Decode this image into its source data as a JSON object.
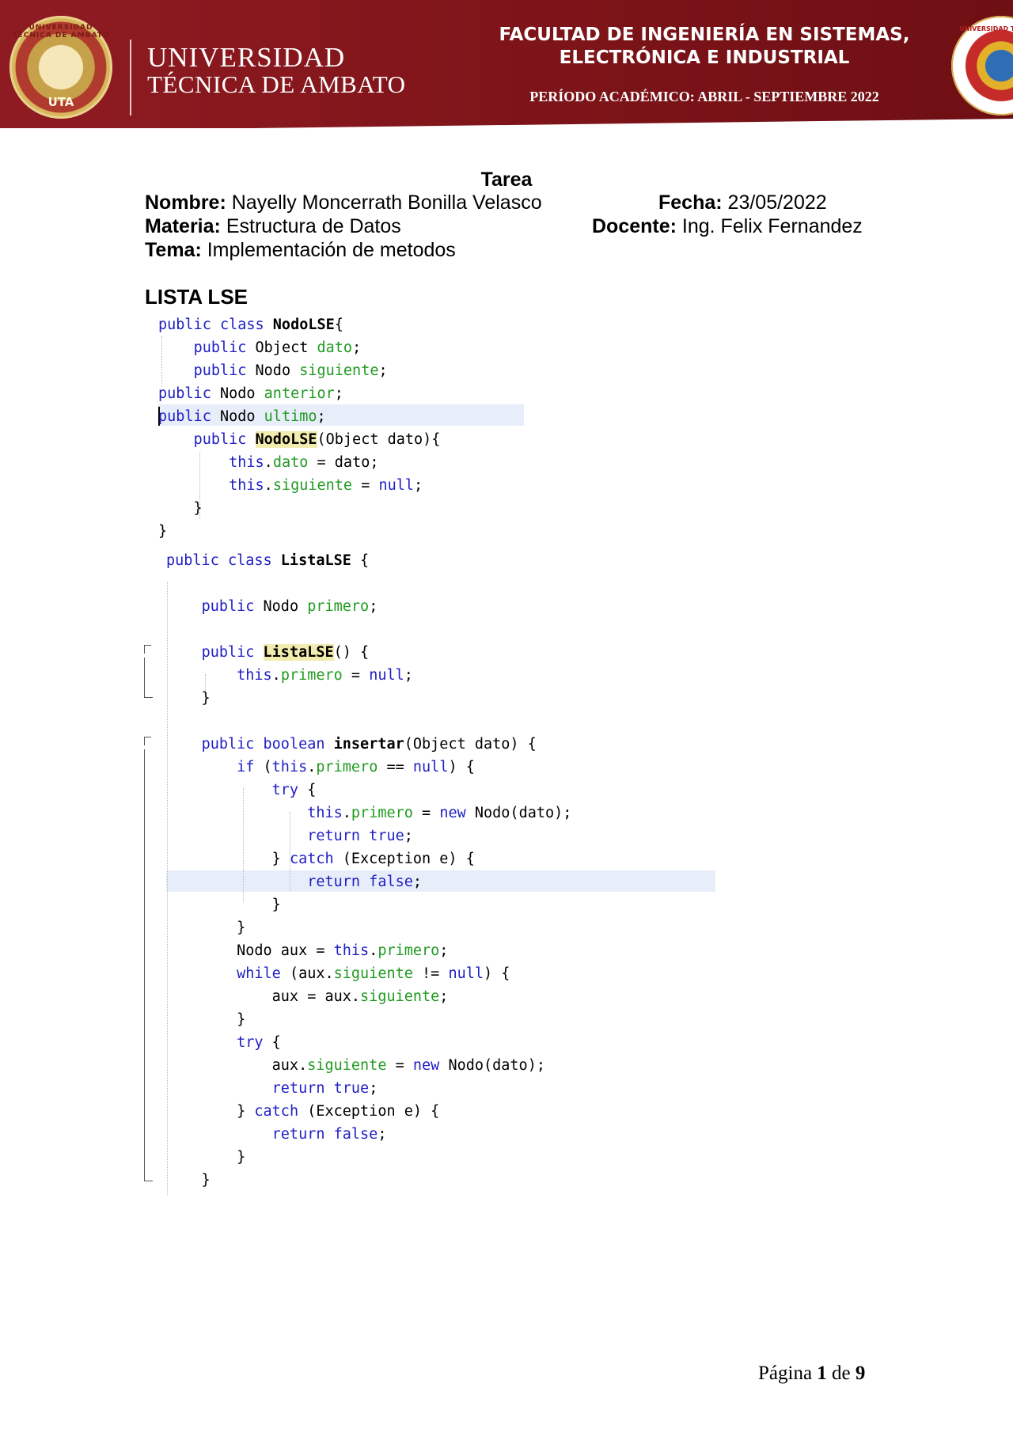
{
  "header": {
    "university_line1": "UNIVERSIDAD",
    "university_line2": "TÉCNICA DE AMBATO",
    "seal_left_text": "UTA",
    "seal_left_arc": "UNIVERSIDAD TÉCNICA DE AMBATO",
    "seal_right_arc": "UNIVERSIDAD TÉCNICA",
    "faculty_line1": "FACULTAD DE INGENIERÍA EN SISTEMAS,",
    "faculty_line2": "ELECTRÓNICA E INDUSTRIAL",
    "period": "PERÍODO ACADÉMICO: ABRIL - SEPTIEMBRE 2022",
    "brand_color": "#8f1b22"
  },
  "document": {
    "title": "Tarea",
    "nombre_label": "Nombre:",
    "nombre_value": " Nayelly Moncerrath Bonilla Velasco",
    "materia_label": "Materia:",
    "materia_value": " Estructura de Datos",
    "tema_label": "Tema:",
    "tema_value": " Implementación de metodos",
    "fecha_label": "Fecha:",
    "fecha_value": " 23/05/2022",
    "docente_label": "Docente:",
    "docente_value": " Ing. Felix Fernandez",
    "section_title": "LISTA LSE"
  },
  "code1": [
    [
      [
        "kw",
        "public class "
      ],
      [
        "bold",
        "NodoLSE"
      ],
      [
        "",
        "{"
      ]
    ],
    [
      [
        "",
        "    "
      ],
      [
        "kw",
        "public "
      ],
      [
        "",
        "Object "
      ],
      [
        "fld",
        "dato"
      ],
      [
        "",
        ";"
      ]
    ],
    [
      [
        "",
        "    "
      ],
      [
        "kw",
        "public "
      ],
      [
        "",
        "Nodo "
      ],
      [
        "fld",
        "siguiente"
      ],
      [
        "",
        ";"
      ]
    ],
    [
      [
        "kw",
        "public "
      ],
      [
        "",
        "Nodo "
      ],
      [
        "fld",
        "anterior"
      ],
      [
        "",
        ";"
      ]
    ],
    [
      [
        "kw",
        "public "
      ],
      [
        "",
        "Nodo "
      ],
      [
        "fld",
        "ultimo"
      ],
      [
        "",
        ";"
      ]
    ],
    [
      [
        "",
        "    "
      ],
      [
        "kw",
        "public "
      ],
      [
        "hl",
        "NodoLSE"
      ],
      [
        "",
        "(Object dato){"
      ]
    ],
    [
      [
        "",
        "        "
      ],
      [
        "kw",
        "this"
      ],
      [
        "",
        "."
      ],
      [
        "fld",
        "dato"
      ],
      [
        "",
        " = dato;"
      ]
    ],
    [
      [
        "",
        "        "
      ],
      [
        "kw",
        "this"
      ],
      [
        "",
        "."
      ],
      [
        "fld",
        "siguiente"
      ],
      [
        "",
        " = "
      ],
      [
        "kw",
        "null"
      ],
      [
        "",
        ";"
      ]
    ],
    [
      [
        "",
        "    }"
      ]
    ],
    [
      [
        "",
        "}"
      ]
    ]
  ],
  "code2": [
    [
      [
        "kw",
        "public class "
      ],
      [
        "bold",
        "ListaLSE"
      ],
      [
        "",
        " {"
      ]
    ],
    [
      [
        "",
        ""
      ]
    ],
    [
      [
        "",
        "    "
      ],
      [
        "kw",
        "public "
      ],
      [
        "",
        "Nodo "
      ],
      [
        "fld",
        "primero"
      ],
      [
        "",
        ";"
      ]
    ],
    [
      [
        "",
        ""
      ]
    ],
    [
      [
        "",
        "    "
      ],
      [
        "kw",
        "public "
      ],
      [
        "hl",
        "ListaLSE"
      ],
      [
        "",
        "() {"
      ]
    ],
    [
      [
        "",
        "        "
      ],
      [
        "kw",
        "this"
      ],
      [
        "",
        "."
      ],
      [
        "fld",
        "primero"
      ],
      [
        "",
        " = "
      ],
      [
        "kw",
        "null"
      ],
      [
        "",
        ";"
      ]
    ],
    [
      [
        "",
        "    }"
      ]
    ],
    [
      [
        "",
        ""
      ]
    ],
    [
      [
        "",
        "    "
      ],
      [
        "kw",
        "public boolean "
      ],
      [
        "bold",
        "insertar"
      ],
      [
        "",
        "(Object dato) {"
      ]
    ],
    [
      [
        "",
        "        "
      ],
      [
        "kw",
        "if "
      ],
      [
        "",
        "("
      ],
      [
        "kw",
        "this"
      ],
      [
        "",
        "."
      ],
      [
        "fld",
        "primero"
      ],
      [
        "",
        " == "
      ],
      [
        "kw",
        "null"
      ],
      [
        "",
        ") {"
      ]
    ],
    [
      [
        "",
        "            "
      ],
      [
        "kw",
        "try "
      ],
      [
        "",
        "{"
      ]
    ],
    [
      [
        "",
        "                "
      ],
      [
        "kw",
        "this"
      ],
      [
        "",
        "."
      ],
      [
        "fld",
        "primero"
      ],
      [
        "",
        " = "
      ],
      [
        "kw",
        "new "
      ],
      [
        "",
        "Nodo(dato);"
      ]
    ],
    [
      [
        "",
        "                "
      ],
      [
        "kw",
        "return true"
      ],
      [
        "",
        ";"
      ]
    ],
    [
      [
        "",
        "            } "
      ],
      [
        "kw",
        "catch "
      ],
      [
        "",
        "(Exception e) {"
      ]
    ],
    [
      [
        "",
        "                "
      ],
      [
        "kw",
        "return false"
      ],
      [
        "",
        ";"
      ]
    ],
    [
      [
        "",
        "            }"
      ]
    ],
    [
      [
        "",
        "        }"
      ]
    ],
    [
      [
        "",
        "        Nodo aux = "
      ],
      [
        "kw",
        "this"
      ],
      [
        "",
        "."
      ],
      [
        "fld",
        "primero"
      ],
      [
        "",
        ";"
      ]
    ],
    [
      [
        "",
        "        "
      ],
      [
        "kw",
        "while "
      ],
      [
        "",
        "(aux."
      ],
      [
        "fld",
        "siguiente"
      ],
      [
        "",
        " != "
      ],
      [
        "kw",
        "null"
      ],
      [
        "",
        ") {"
      ]
    ],
    [
      [
        "",
        "            aux = aux."
      ],
      [
        "fld",
        "siguiente"
      ],
      [
        "",
        ";"
      ]
    ],
    [
      [
        "",
        "        }"
      ]
    ],
    [
      [
        "",
        "        "
      ],
      [
        "kw",
        "try "
      ],
      [
        "",
        "{"
      ]
    ],
    [
      [
        "",
        "            aux."
      ],
      [
        "fld",
        "siguiente"
      ],
      [
        "",
        " = "
      ],
      [
        "kw",
        "new "
      ],
      [
        "",
        "Nodo(dato);"
      ]
    ],
    [
      [
        "",
        "            "
      ],
      [
        "kw",
        "return true"
      ],
      [
        "",
        ";"
      ]
    ],
    [
      [
        "",
        "        } "
      ],
      [
        "kw",
        "catch "
      ],
      [
        "",
        "(Exception e) {"
      ]
    ],
    [
      [
        "",
        "            "
      ],
      [
        "kw",
        "return false"
      ],
      [
        "",
        ";"
      ]
    ],
    [
      [
        "",
        "        }"
      ]
    ],
    [
      [
        "",
        "    }"
      ]
    ]
  ],
  "footer": {
    "page_word": "Página ",
    "page_num": "1",
    "of_word": " de ",
    "page_total": "9"
  }
}
